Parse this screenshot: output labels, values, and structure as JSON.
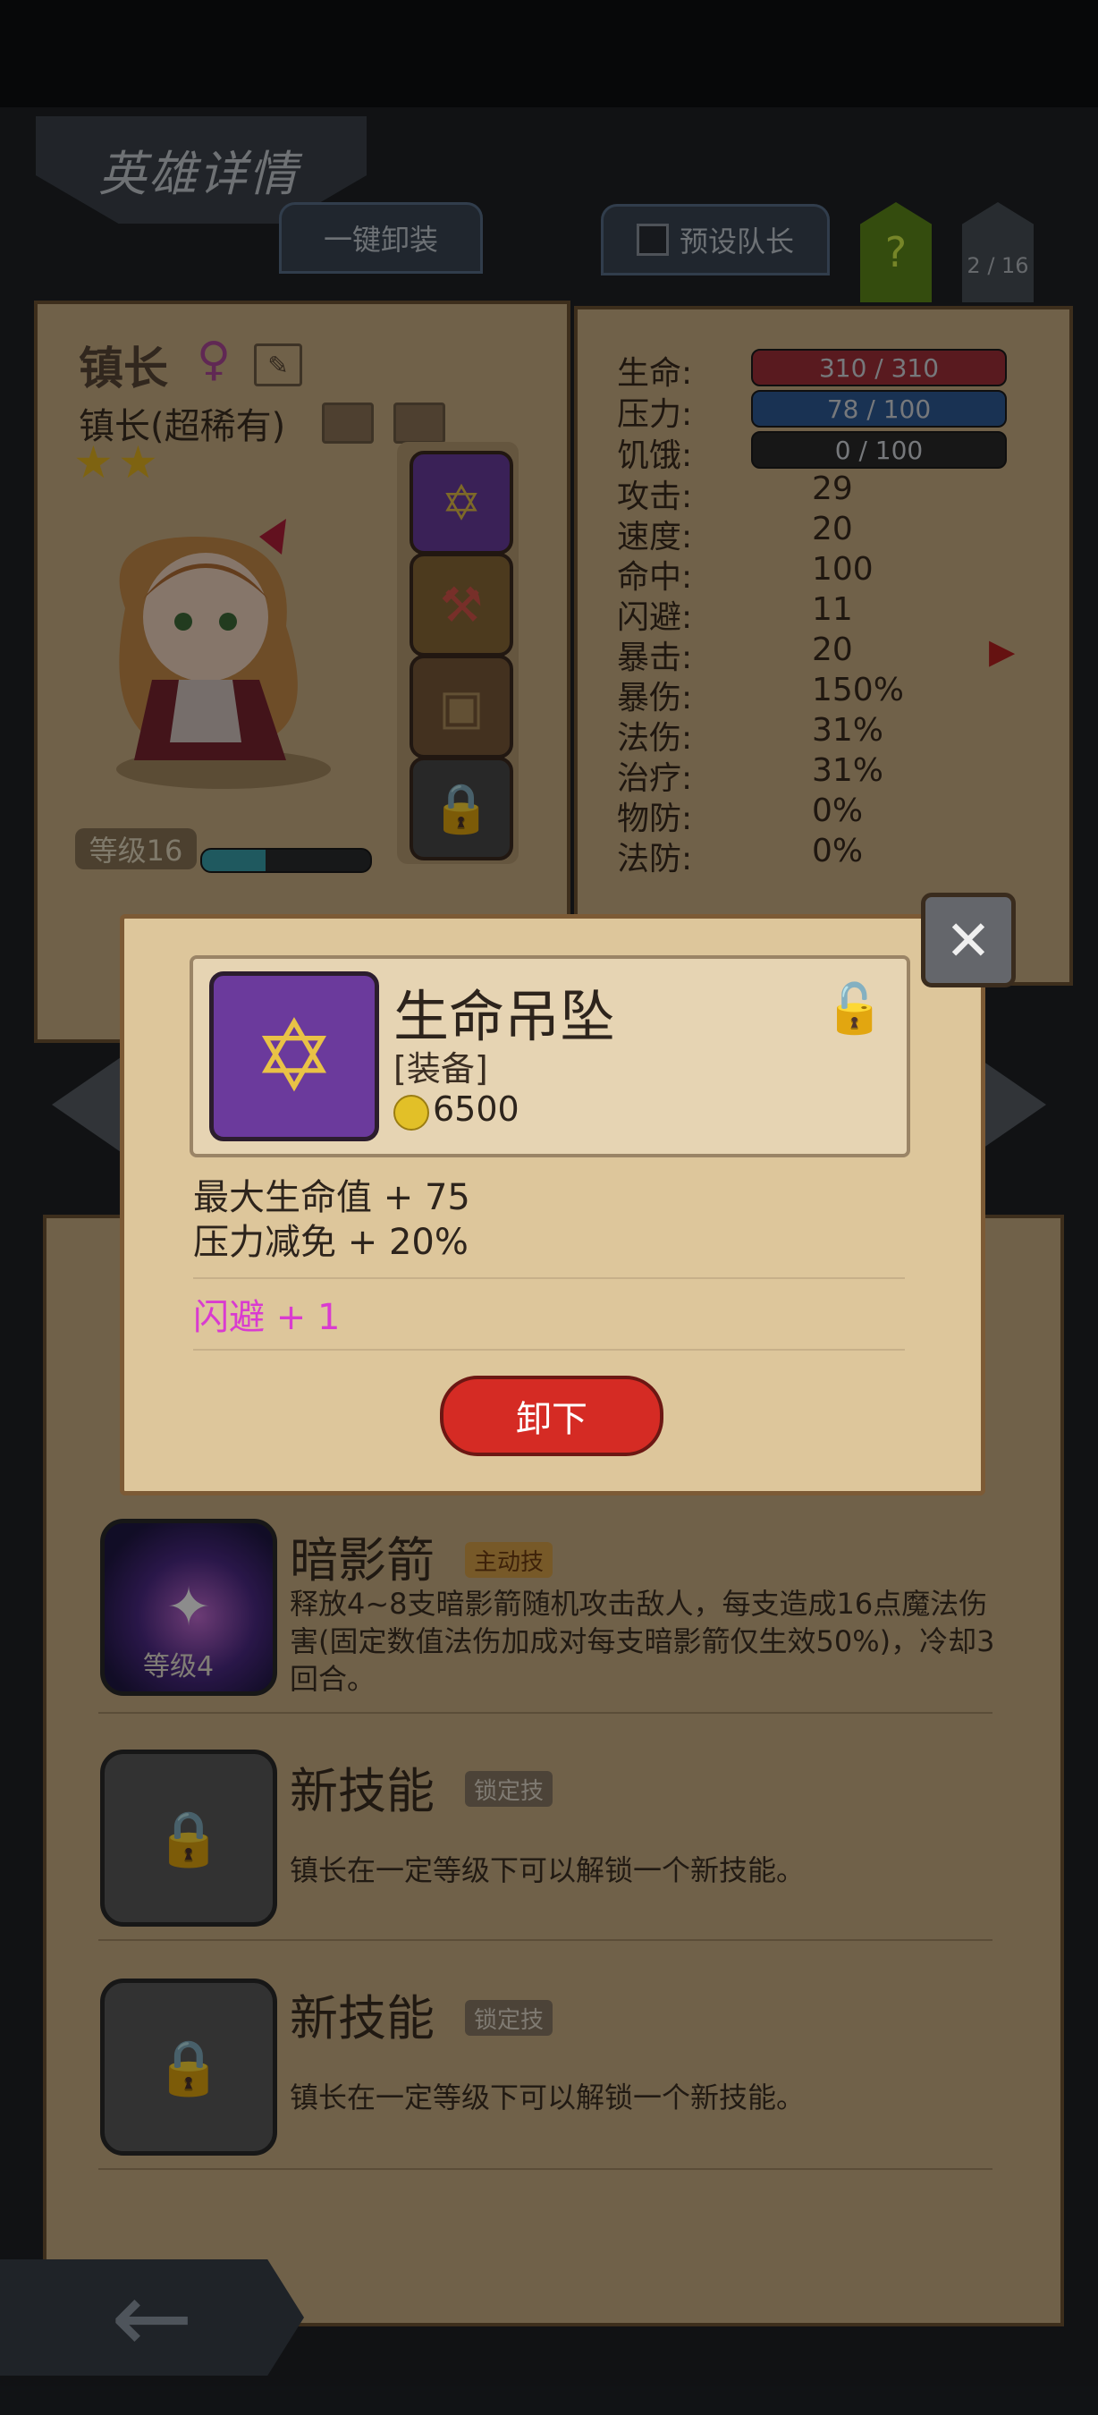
{
  "header": {
    "title": "英雄详情"
  },
  "top_buttons": {
    "unequip_all": "一键卸装",
    "preset_captain": "预设队长",
    "help": "?",
    "page": "2 / 16"
  },
  "hero": {
    "name": "镇长",
    "class": "镇长(超稀有)",
    "stars": 2,
    "level": "等级16",
    "xp_fraction": 0.38
  },
  "stats": {
    "hp_label": "生命:",
    "hp_value": "310 / 310",
    "stress_label": "压力:",
    "stress_value": "78 / 100",
    "hunger_label": "饥饿:",
    "hunger_value": "0 / 100",
    "rows": [
      {
        "label": "攻击:",
        "value": "29"
      },
      {
        "label": "速度:",
        "value": "20"
      },
      {
        "label": "命中:",
        "value": "100"
      },
      {
        "label": "闪避:",
        "value": "11"
      },
      {
        "label": "暴击:",
        "value": "20"
      },
      {
        "label": "暴伤:",
        "value": "150%"
      },
      {
        "label": "法伤:",
        "value": "31%"
      },
      {
        "label": "治疗:",
        "value": "31%"
      },
      {
        "label": "物防:",
        "value": "0%"
      },
      {
        "label": "法防:",
        "value": "0%"
      }
    ]
  },
  "skills": [
    {
      "name": "暗影箭",
      "tag": "主动技",
      "level": "等级4",
      "desc": "释放4~8支暗影箭随机攻击敌人，每支造成16点魔法伤害(固定数值法伤加成对每支暗影箭仅生效50%)，冷却3回合。"
    },
    {
      "name": "新技能",
      "tag": "锁定技",
      "desc": "镇长在一定等级下可以解锁一个新技能。"
    },
    {
      "name": "新技能",
      "tag": "锁定技",
      "desc": "镇长在一定等级下可以解锁一个新技能。"
    }
  ],
  "modal": {
    "item_name": "生命吊坠",
    "item_type": "[装备]",
    "price": "6500",
    "stat1": "最大生命值 + 75",
    "stat2": "压力减免 + 20%",
    "bonus": "闪避 + 1",
    "remove_label": "卸下"
  },
  "icons": {
    "gender": "female-icon",
    "edit": "edit-icon",
    "equip_slots": [
      "pendant-icon",
      "axe-icon",
      "chest-icon",
      "lock-icon"
    ],
    "close": "close-icon",
    "item_lock": "unlock-icon",
    "back": "back-arrow-icon"
  },
  "colors": {
    "hp_bar": "#a3303a",
    "stress_bar": "#2f5b98",
    "remove_button": "#d52b24",
    "bonus_text": "#d93bd0"
  }
}
